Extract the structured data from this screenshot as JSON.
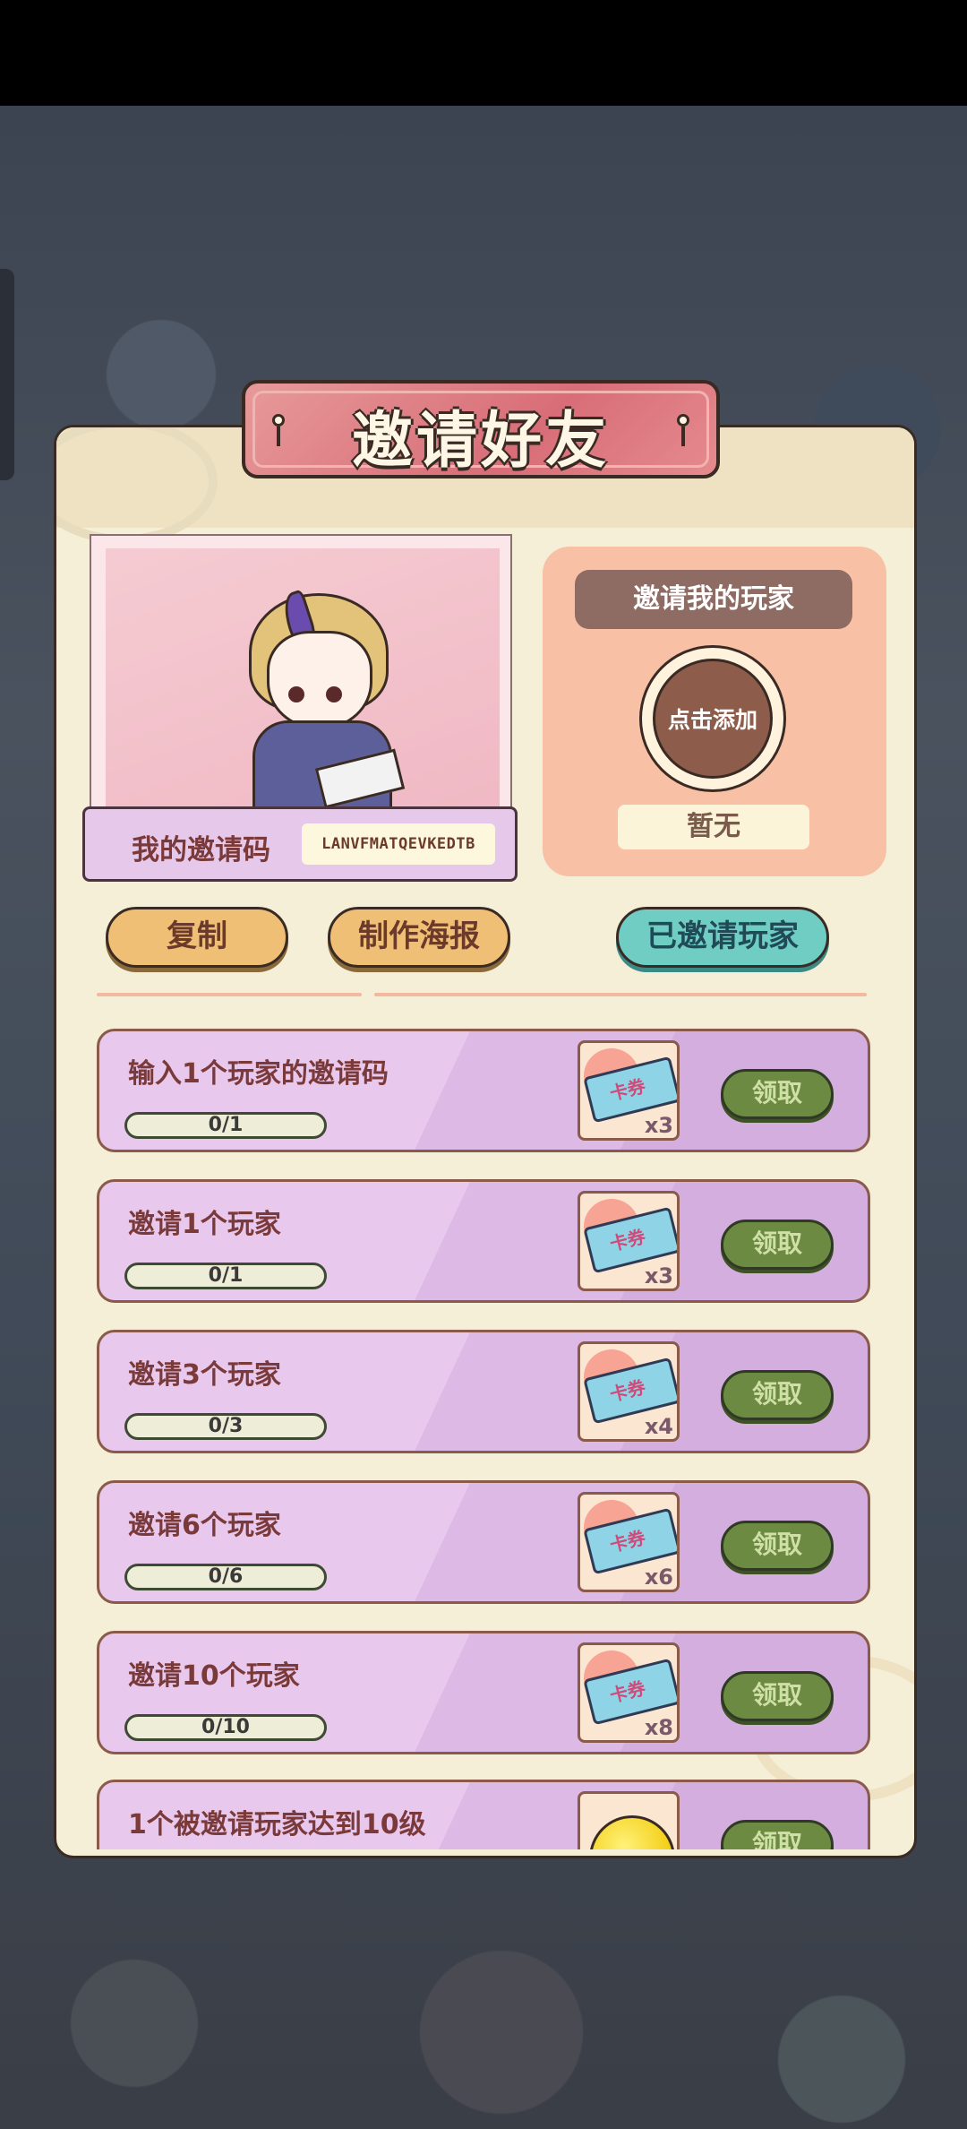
{
  "title": "邀请好友",
  "invite_code": {
    "label": "我的邀请码",
    "value": "LANVFMATQEVKEDTB"
  },
  "inviter": {
    "header": "邀请我的玩家",
    "add_button": "点击添加",
    "status": "暂无"
  },
  "actions": {
    "copy": "复制",
    "poster": "制作海报",
    "invited_players": "已邀请玩家"
  },
  "tasks": [
    {
      "name": "输入1个玩家的邀请码",
      "progress": "0/1",
      "reward_icon": "card-ticket-icon",
      "reward_label": "卡券",
      "reward_qty": "x3",
      "claim": "领取"
    },
    {
      "name": "邀请1个玩家",
      "progress": "0/1",
      "reward_icon": "card-ticket-icon",
      "reward_label": "卡券",
      "reward_qty": "x3",
      "claim": "领取"
    },
    {
      "name": "邀请3个玩家",
      "progress": "0/3",
      "reward_icon": "card-ticket-icon",
      "reward_label": "卡券",
      "reward_qty": "x4",
      "claim": "领取"
    },
    {
      "name": "邀请6个玩家",
      "progress": "0/6",
      "reward_icon": "card-ticket-icon",
      "reward_label": "卡券",
      "reward_qty": "x6",
      "claim": "领取"
    },
    {
      "name": "邀请10个玩家",
      "progress": "0/10",
      "reward_icon": "card-ticket-icon",
      "reward_label": "卡券",
      "reward_qty": "x8",
      "claim": "领取"
    },
    {
      "name": "1个被邀请玩家达到10级",
      "progress": "",
      "reward_icon": "gold-coin-icon",
      "reward_label": "",
      "reward_qty": "",
      "claim": "领取"
    }
  ],
  "colors": {
    "panel": "#f6efd8",
    "title_banner": "#d86d78",
    "task_card": "#e8c8ec",
    "claim_button": "#6d8a43",
    "gold_button": "#f0bf76",
    "teal_button": "#6fcdc4"
  }
}
